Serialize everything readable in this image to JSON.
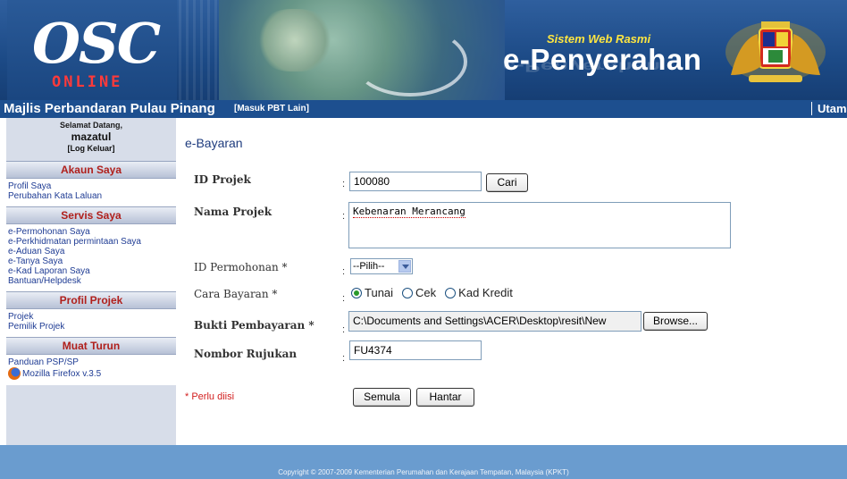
{
  "banner": {
    "logo_letters": "OSC",
    "logo_sub": "ONLINE",
    "tagline": "Sistem Web Rasmi",
    "product": "e-Penyerahan",
    "product_reflection": "e-Penyerahan"
  },
  "titlebar": {
    "council": "Majlis Perbandaran Pulau Pinang",
    "switch_link": "[Masuk PBT Lain]",
    "home_link": "Utama"
  },
  "sidebar": {
    "welcome": "Selamat Datang,",
    "user": "mazatul",
    "logout": "[Log Keluar]",
    "sections": [
      {
        "title": "Akaun Saya",
        "items": [
          "Profil Saya",
          "Perubahan Kata Laluan"
        ]
      },
      {
        "title": "Servis Saya",
        "items": [
          "e-Permohonan Saya",
          "e-Perkhidmatan permintaan Saya",
          "e-Aduan Saya",
          "e-Tanya Saya",
          "e-Kad Laporan Saya",
          "Bantuan/Helpdesk"
        ]
      },
      {
        "title": "Profil Projek",
        "items": [
          "Projek",
          "Pemilik Projek"
        ]
      },
      {
        "title": "Muat Turun",
        "items": [
          "Panduan PSP/SP",
          "Mozilla Firefox v.3.5"
        ]
      }
    ]
  },
  "form": {
    "heading": "e-Bayaran",
    "id_projek_label": "ID Projek",
    "id_projek_value": "100080",
    "cari_button": "Cari",
    "nama_projek_label": "Nama Projek",
    "nama_projek_value": "Kebenaran Merancang",
    "id_permohonan_label": "ID Permohonan *",
    "id_permohonan_selected": "--Pilih--",
    "cara_bayaran_label": "Cara Bayaran *",
    "cara_bayaran_options": [
      "Tunai",
      "Cek",
      "Kad Kredit"
    ],
    "cara_bayaran_selected": "Tunai",
    "bukti_label": "Bukti Pembayaran *",
    "bukti_value": "C:\\Documents and Settings\\ACER\\Desktop\\resit\\New",
    "browse_button": "Browse...",
    "nombor_label": "Nombor Rujukan",
    "nombor_value": "FU4374",
    "required_note": "* Perlu diisi",
    "reset_button": "Semula",
    "submit_button": "Hantar",
    "colon": ":"
  },
  "footer": {
    "copyright": "Copyright © 2007-2009 Kementerian Perumahan dan Kerajaan Tempatan, Malaysia (KPKT)"
  },
  "colors": {
    "banner": "#1c4a86",
    "titlebar": "#1d4f8f",
    "sidebar": "#d7dde9",
    "section_title": "#b0201c",
    "link": "#1f3c94",
    "footer": "#6a9ccf",
    "required": "#d21d1d"
  }
}
